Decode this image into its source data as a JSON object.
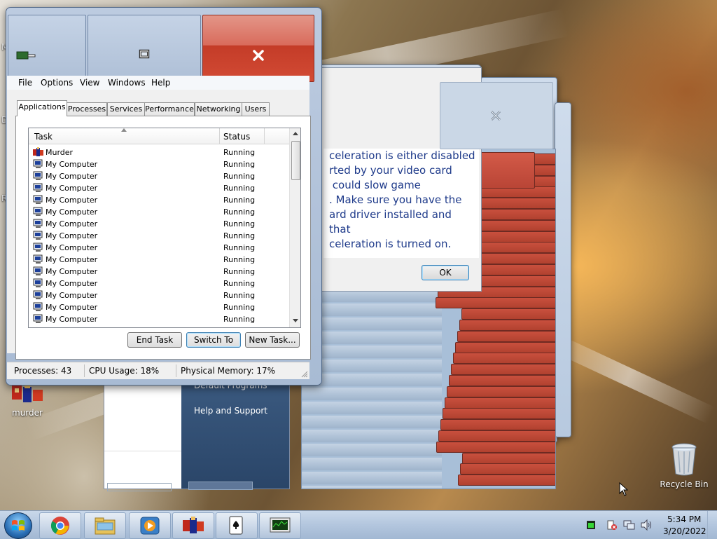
{
  "desktop": {
    "edge_letters": [
      "M",
      "D",
      "R"
    ],
    "icons": [
      {
        "label": "murder",
        "icon": "murder-game-icon"
      },
      {
        "label": "Recycle Bin",
        "icon": "recycle-bin-icon"
      }
    ]
  },
  "background_start_menu": {
    "items": [
      "Default Programs",
      "Help and Support"
    ]
  },
  "message_dialog": {
    "text_lines": [
      "celeration is either disabled",
      "rted by your video card",
      " could slow game",
      ". Make sure you have the",
      "ard driver installed and that",
      "celeration is turned on."
    ],
    "ok_label": "OK"
  },
  "task_manager": {
    "menu": [
      "File",
      "Options",
      "View",
      "Windows",
      "Help"
    ],
    "tabs": [
      "Applications",
      "Processes",
      "Services",
      "Performance",
      "Networking",
      "Users"
    ],
    "active_tab": "Applications",
    "columns": [
      "Task",
      "Status"
    ],
    "rows": [
      {
        "task": "Murder",
        "status": "Running",
        "icon": "murder-game-icon"
      },
      {
        "task": "My Computer",
        "status": "Running",
        "icon": "computer-icon"
      },
      {
        "task": "My Computer",
        "status": "Running",
        "icon": "computer-icon"
      },
      {
        "task": "My Computer",
        "status": "Running",
        "icon": "computer-icon"
      },
      {
        "task": "My Computer",
        "status": "Running",
        "icon": "computer-icon"
      },
      {
        "task": "My Computer",
        "status": "Running",
        "icon": "computer-icon"
      },
      {
        "task": "My Computer",
        "status": "Running",
        "icon": "computer-icon"
      },
      {
        "task": "My Computer",
        "status": "Running",
        "icon": "computer-icon"
      },
      {
        "task": "My Computer",
        "status": "Running",
        "icon": "computer-icon"
      },
      {
        "task": "My Computer",
        "status": "Running",
        "icon": "computer-icon"
      },
      {
        "task": "My Computer",
        "status": "Running",
        "icon": "computer-icon"
      },
      {
        "task": "My Computer",
        "status": "Running",
        "icon": "computer-icon"
      },
      {
        "task": "My Computer",
        "status": "Running",
        "icon": "computer-icon"
      },
      {
        "task": "My Computer",
        "status": "Running",
        "icon": "computer-icon"
      },
      {
        "task": "My Computer",
        "status": "Running",
        "icon": "computer-icon"
      }
    ],
    "buttons": {
      "end_task": "End Task",
      "switch_to": "Switch To",
      "new_task": "New Task..."
    },
    "status_bar": {
      "processes": "Processes: 43",
      "cpu": "CPU Usage: 18%",
      "memory": "Physical Memory: 17%"
    }
  },
  "taskbar": {
    "pinned": [
      "start-orb",
      "chrome-icon",
      "explorer-icon",
      "media-player-icon",
      "murder-game-icon",
      "solitaire-icon",
      "task-manager-icon"
    ],
    "clock_time": "5:34 PM",
    "clock_date": "3/20/2022"
  },
  "colors": {
    "card_red": "#c9503e",
    "close_button_red": "#c43c28",
    "dialog_text": "#1e3a8a"
  }
}
